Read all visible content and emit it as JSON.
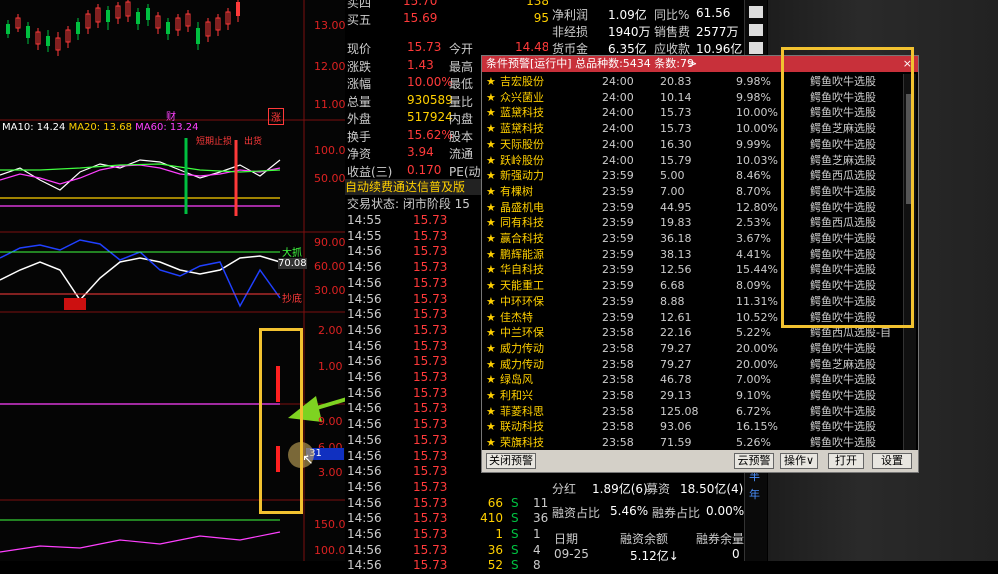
{
  "colors": {
    "up": "#ff3a3a",
    "down": "#00c040",
    "yellow": "#ffd000",
    "accent": "#f2c230"
  },
  "chart": {
    "price_labels": [
      "13.00",
      "12.00",
      "11.00"
    ],
    "ma_legend": {
      "ma10": "MA10: 14.24",
      "ma20": "MA20: 13.68",
      "ma60": "MA60: 13.24"
    },
    "mid_badges": [
      "财",
      "涨"
    ],
    "ind1_labels": [
      "100.0",
      "50.00"
    ],
    "ind1_annotations": [
      "短期止损",
      "出货"
    ],
    "ind2_labels": [
      "90.00",
      "60.00",
      "30.00"
    ],
    "ind2_annotations": {
      "top": "大抓",
      "value": "70.08",
      "bottom": "抄底"
    },
    "ind3_labels": [
      "2.00",
      "1.00"
    ],
    "ind4_labels": [
      "9.00",
      "6.00",
      "3.00"
    ],
    "ind4_value": ".31",
    "ind5_labels": [
      "150.0",
      "100.0"
    ]
  },
  "quote": {
    "top_rows": [
      {
        "label": "买四",
        "price": "15.70",
        "vol": "138"
      },
      {
        "label": "买五",
        "price": "15.69",
        "vol": "95"
      }
    ],
    "stats": [
      {
        "label": "现价",
        "value": "15.73",
        "label2": "今开",
        "value2": "14.48"
      },
      {
        "label": "涨跌",
        "value": "1.43",
        "label2": "最高",
        "value2": ""
      },
      {
        "label": "涨幅",
        "value": "10.00%",
        "label2": "最低",
        "value2": ""
      },
      {
        "label": "总量",
        "value": "930589",
        "label2": "量比",
        "value2": ""
      },
      {
        "label": "外盘",
        "value": "517924",
        "label2": "内盘",
        "value2": ""
      },
      {
        "label": "换手",
        "value": "15.62%",
        "label2": "股本",
        "value2": ""
      },
      {
        "label": "净资",
        "value": "3.94",
        "label2": "流通",
        "value2": ""
      },
      {
        "label": "收益(三)",
        "value": "0.170",
        "label2": "PE(动)",
        "value2": ""
      }
    ],
    "banner": "自动续费通达信普及版",
    "trade_status": "交易状态: 闭市阶段 15",
    "ticks": [
      {
        "time": "14:55",
        "price": "15.73",
        "vol": "",
        "flag": "",
        "num": ""
      },
      {
        "time": "14:55",
        "price": "15.73",
        "vol": "",
        "flag": "",
        "num": ""
      },
      {
        "time": "14:56",
        "price": "15.73",
        "vol": "",
        "flag": "",
        "num": ""
      },
      {
        "time": "14:56",
        "price": "15.73",
        "vol": "",
        "flag": "",
        "num": ""
      },
      {
        "time": "14:56",
        "price": "15.73",
        "vol": "",
        "flag": "",
        "num": ""
      },
      {
        "time": "14:56",
        "price": "15.73",
        "vol": "",
        "flag": "",
        "num": ""
      },
      {
        "time": "14:56",
        "price": "15.73",
        "vol": "",
        "flag": "",
        "num": ""
      },
      {
        "time": "14:56",
        "price": "15.73",
        "vol": "",
        "flag": "",
        "num": ""
      },
      {
        "time": "14:56",
        "price": "15.73",
        "vol": "",
        "flag": "",
        "num": ""
      },
      {
        "time": "14:56",
        "price": "15.73",
        "vol": "",
        "flag": "",
        "num": ""
      },
      {
        "time": "14:56",
        "price": "15.73",
        "vol": "",
        "flag": "",
        "num": ""
      },
      {
        "time": "14:56",
        "price": "15.73",
        "vol": "",
        "flag": "",
        "num": ""
      },
      {
        "time": "14:56",
        "price": "15.73",
        "vol": "",
        "flag": "",
        "num": ""
      },
      {
        "time": "14:56",
        "price": "15.73",
        "vol": "",
        "flag": "",
        "num": ""
      },
      {
        "time": "14:56",
        "price": "15.73",
        "vol": "",
        "flag": "",
        "num": ""
      },
      {
        "time": "14:56",
        "price": "15.73",
        "vol": "",
        "flag": "",
        "num": ""
      },
      {
        "time": "14:56",
        "price": "15.73",
        "vol": "",
        "flag": "",
        "num": ""
      },
      {
        "time": "14:56",
        "price": "15.73",
        "vol": "",
        "flag": "",
        "num": ""
      },
      {
        "time": "14:56",
        "price": "15.73",
        "vol": "66",
        "flag": "S",
        "num": "11"
      },
      {
        "time": "14:56",
        "price": "15.73",
        "vol": "410",
        "flag": "S",
        "num": "36"
      },
      {
        "time": "14:56",
        "price": "15.73",
        "vol": "1",
        "flag": "S",
        "num": "1"
      },
      {
        "time": "14:56",
        "price": "15.73",
        "vol": "36",
        "flag": "S",
        "num": "4"
      },
      {
        "time": "14:56",
        "price": "15.73",
        "vol": "52",
        "flag": "S",
        "num": "8"
      }
    ]
  },
  "finance": {
    "top_rows": [
      {
        "l1": "净利润",
        "v1": "1.09亿",
        "l2": "同比%",
        "v2": "61.56"
      },
      {
        "l1": "非经损",
        "v1": "1940万",
        "l2": "销售费",
        "v2": "2577万"
      },
      {
        "l1": "货币金",
        "v1": "6.35亿",
        "l2": "应收款",
        "v2": "10.96亿"
      }
    ],
    "bottom_rows": [
      {
        "l1": "分红",
        "v1": "1.89亿(6)",
        "l2": "募资",
        "v2": "18.50亿(4)"
      },
      {
        "l1": "融资占比",
        "v1": "5.46%",
        "l2": "融券占比",
        "v2": "0.00%"
      }
    ],
    "table_head": {
      "c1": "日期",
      "c2": "融资余额",
      "c3": "融券余量"
    },
    "table_row": {
      "c1": "09-25",
      "c2": "5.12亿↓",
      "c3": "0"
    },
    "side_labels": [
      "半",
      "年"
    ]
  },
  "popup": {
    "title": "条件预警[运行中] 总品种数:5434 条数:79",
    "title_arrow": ">",
    "close": "×",
    "rows": [
      {
        "name": "吉宏股份",
        "time": "24:00",
        "price": "20.83",
        "pct": "9.98%",
        "formula": "鳄鱼吹牛选股"
      },
      {
        "name": "众兴菌业",
        "time": "24:00",
        "price": "10.14",
        "pct": "9.98%",
        "formula": "鳄鱼吹牛选股"
      },
      {
        "name": "蓝黛科技",
        "time": "24:00",
        "price": "15.73",
        "pct": "10.00%",
        "formula": "鳄鱼吹牛选股"
      },
      {
        "name": "蓝黛科技",
        "time": "24:00",
        "price": "15.73",
        "pct": "10.00%",
        "formula": "鳄鱼芝麻选股"
      },
      {
        "name": "天际股份",
        "time": "24:00",
        "price": "16.30",
        "pct": "9.99%",
        "formula": "鳄鱼吹牛选股"
      },
      {
        "name": "跃岭股份",
        "time": "24:00",
        "price": "15.79",
        "pct": "10.03%",
        "formula": "鳄鱼芝麻选股"
      },
      {
        "name": "新强动力",
        "time": "23:59",
        "price": "5.00",
        "pct": "8.46%",
        "formula": "鳄鱼西瓜选股"
      },
      {
        "name": "有棵树",
        "time": "23:59",
        "price": "7.00",
        "pct": "8.70%",
        "formula": "鳄鱼吹牛选股"
      },
      {
        "name": "晶盛机电",
        "time": "23:59",
        "price": "44.95",
        "pct": "12.80%",
        "formula": "鳄鱼吹牛选股"
      },
      {
        "name": "同有科技",
        "time": "23:59",
        "price": "19.83",
        "pct": "2.53%",
        "formula": "鳄鱼西瓜选股"
      },
      {
        "name": "赢合科技",
        "time": "23:59",
        "price": "36.18",
        "pct": "3.67%",
        "formula": "鳄鱼吹牛选股"
      },
      {
        "name": "鹏辉能源",
        "time": "23:59",
        "price": "38.13",
        "pct": "4.41%",
        "formula": "鳄鱼吹牛选股"
      },
      {
        "name": "华自科技",
        "time": "23:59",
        "price": "12.56",
        "pct": "15.44%",
        "formula": "鳄鱼吹牛选股"
      },
      {
        "name": "天能重工",
        "time": "23:59",
        "price": "6.68",
        "pct": "8.09%",
        "formula": "鳄鱼吹牛选股"
      },
      {
        "name": "中环环保",
        "time": "23:59",
        "price": "8.88",
        "pct": "11.31%",
        "formula": "鳄鱼吹牛选股"
      },
      {
        "name": "佳杰特",
        "time": "23:59",
        "price": "12.61",
        "pct": "10.52%",
        "formula": "鳄鱼吹牛选股"
      },
      {
        "name": "中兰环保",
        "time": "23:58",
        "price": "22.16",
        "pct": "5.22%",
        "formula": "鳄鱼西瓜选股-自"
      },
      {
        "name": "威力传动",
        "time": "23:58",
        "price": "79.27",
        "pct": "20.00%",
        "formula": "鳄鱼吹牛选股"
      },
      {
        "name": "威力传动",
        "time": "23:58",
        "price": "79.27",
        "pct": "20.00%",
        "formula": "鳄鱼芝麻选股"
      },
      {
        "name": "绿岛风",
        "time": "23:58",
        "price": "46.78",
        "pct": "7.00%",
        "formula": "鳄鱼吹牛选股"
      },
      {
        "name": "利和兴",
        "time": "23:58",
        "price": "29.13",
        "pct": "9.10%",
        "formula": "鳄鱼吹牛选股"
      },
      {
        "name": "菲菱科思",
        "time": "23:58",
        "price": "125.08",
        "pct": "6.72%",
        "formula": "鳄鱼吹牛选股"
      },
      {
        "name": "联动科技",
        "time": "23:58",
        "price": "93.06",
        "pct": "16.15%",
        "formula": "鳄鱼吹牛选股"
      },
      {
        "name": "荣旗科技",
        "time": "23:58",
        "price": "71.59",
        "pct": "5.26%",
        "formula": "鳄鱼吹牛选股"
      }
    ],
    "buttons": {
      "close_alert": "关闭预警",
      "cloud_alert": "云预警",
      "operate": "操作∨",
      "open": "打开",
      "settings": "设置"
    }
  }
}
